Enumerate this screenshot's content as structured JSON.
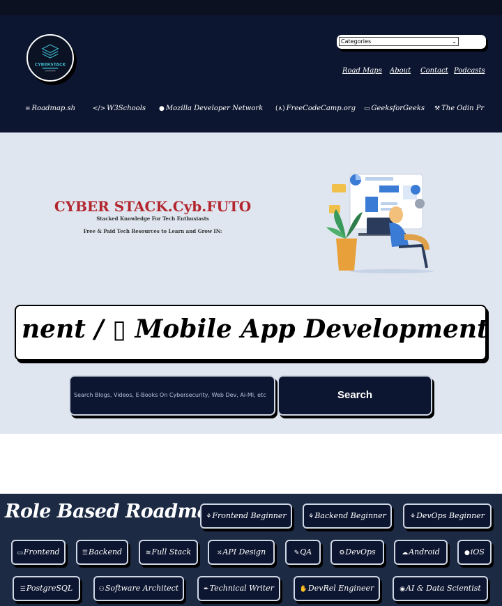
{
  "header": {
    "logo_text": "CYBERSTACK",
    "categories_select": "Categories",
    "nav": [
      "Road Maps",
      "About",
      "Contact",
      "Podcasts"
    ],
    "quick_links": [
      {
        "icon": "bars-icon",
        "glyph": "≡",
        "label": "Roadmap.sh"
      },
      {
        "icon": "code-icon",
        "glyph": "</>",
        "label": "W3Schools"
      },
      {
        "icon": "firefox-icon",
        "glyph": "●",
        "label": "Mozilla Developer Network"
      },
      {
        "icon": "fcc-icon",
        "glyph": "(∧)",
        "label": "FreeCodeCamp.org"
      },
      {
        "icon": "laptop-icon",
        "glyph": "▭",
        "label": "GeeksforGeeks"
      },
      {
        "icon": "hammer-icon",
        "glyph": "⚒",
        "label": "The Odin Pr"
      }
    ]
  },
  "hero": {
    "title": "CYBER STACK.Cyb.FUTO",
    "subtitle": "Stacked Knowledge For Tech Enthusiasts",
    "tagline": "Free & Paid Tech Resources to Learn and Grow IN:",
    "marquee": "nent  /  ▯ Mobile App Development  /  ◐"
  },
  "search": {
    "placeholder": "Search Blogs, Videos, E-Books On Cybersecurity, Web Dev, Ai-Ml, etc",
    "button": "Search"
  },
  "roles": {
    "title": "Role Based Roadmaps",
    "row1": [
      {
        "icon": "seedling-icon",
        "glyph": "⚘",
        "label": "Frontend Beginner"
      },
      {
        "icon": "seedling-icon",
        "glyph": "⚘",
        "label": "Backend Beginner"
      },
      {
        "icon": "seedling-icon",
        "glyph": "⚘",
        "label": "DevOps Beginner"
      }
    ],
    "row2": [
      {
        "icon": "desktop-icon",
        "glyph": "▭",
        "label": "Frontend"
      },
      {
        "icon": "server-icon",
        "glyph": "☰",
        "label": "Backend"
      },
      {
        "icon": "layers-icon",
        "glyph": "≋",
        "label": "Full Stack"
      },
      {
        "icon": "shuffle-icon",
        "glyph": "⤭",
        "label": "API Design"
      },
      {
        "icon": "pen-icon",
        "glyph": "✎",
        "label": "QA"
      },
      {
        "icon": "gears-icon",
        "glyph": "⚙",
        "label": "DevOps"
      },
      {
        "icon": "android-icon",
        "glyph": "☁",
        "label": "Android"
      },
      {
        "icon": "apple-icon",
        "glyph": "●",
        "label": "iOS"
      }
    ],
    "row3": [
      {
        "icon": "database-icon",
        "glyph": "☰",
        "label": "PostgreSQL"
      },
      {
        "icon": "users-icon",
        "glyph": "⚇",
        "label": "Software Architect"
      },
      {
        "icon": "feather-icon",
        "glyph": "✒",
        "label": "Technical Writer"
      },
      {
        "icon": "handshake-icon",
        "glyph": "✋",
        "label": "DevRel Engineer"
      },
      {
        "icon": "brain-icon",
        "glyph": "◉",
        "label": "AI & Data Scientist"
      }
    ]
  },
  "colors": {
    "navy": "#0d1630",
    "hero_bg": "#dfe6ef",
    "title_red": "#b3262f",
    "roles_bg": "#1c2a44"
  }
}
